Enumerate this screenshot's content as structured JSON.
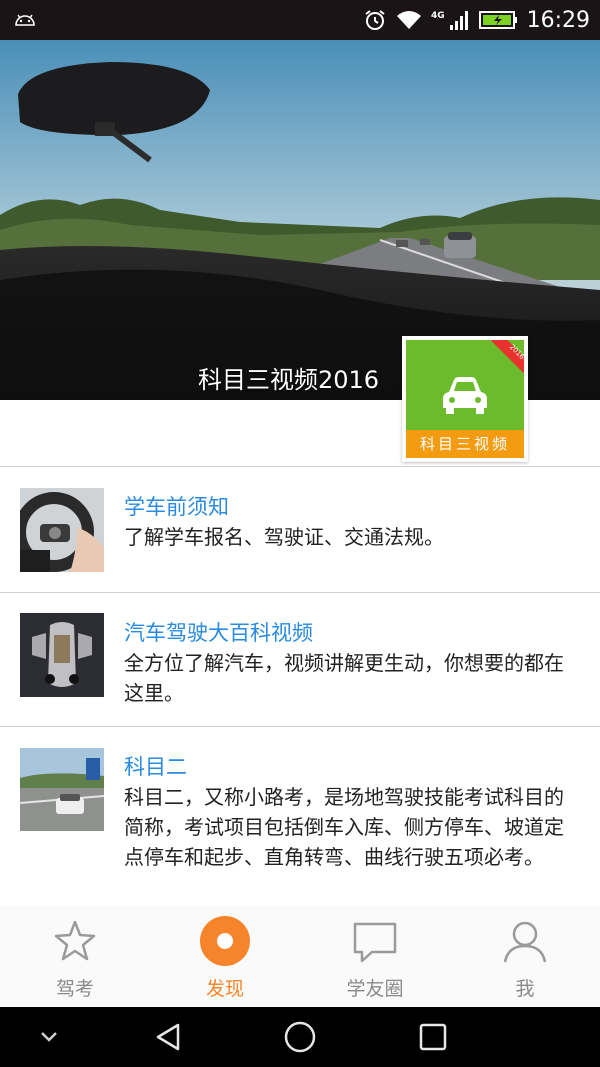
{
  "status_bar": {
    "time": "16:29",
    "network": "4G",
    "icons": [
      "android-icon",
      "alarm-icon",
      "wifi-icon",
      "signal-icon",
      "battery-charging-icon"
    ]
  },
  "hero": {
    "title": "科目三视频2016",
    "tile": {
      "label": "科目三视频",
      "ribbon": "2016",
      "background": "#6bbb2c",
      "label_background": "#f39c12"
    }
  },
  "items": [
    {
      "title": "学车前须知",
      "desc": "了解学车报名、驾驶证、交通法规。"
    },
    {
      "title": "汽车驾驶大百科视频",
      "desc": "全方位了解汽车，视频讲解更生动，你想要的都在这里。"
    },
    {
      "title": "科目二",
      "desc": "科目二，又称小路考，是场地驾驶技能考试科目的简称，考试项目包括倒车入库、侧方停车、坡道定点停车和起步、直角转弯、曲线行驶五项必考。"
    }
  ],
  "bottom_nav": [
    {
      "label": "驾考",
      "icon": "star-icon",
      "active": false
    },
    {
      "label": "发现",
      "icon": "discover-icon",
      "active": true
    },
    {
      "label": "学友圈",
      "icon": "chat-bubble-icon",
      "active": false
    },
    {
      "label": "我",
      "icon": "person-icon",
      "active": false
    }
  ],
  "colors": {
    "accent": "#f5842a",
    "link_blue": "#2a8be0",
    "nav_inactive": "#8a8a8a"
  }
}
